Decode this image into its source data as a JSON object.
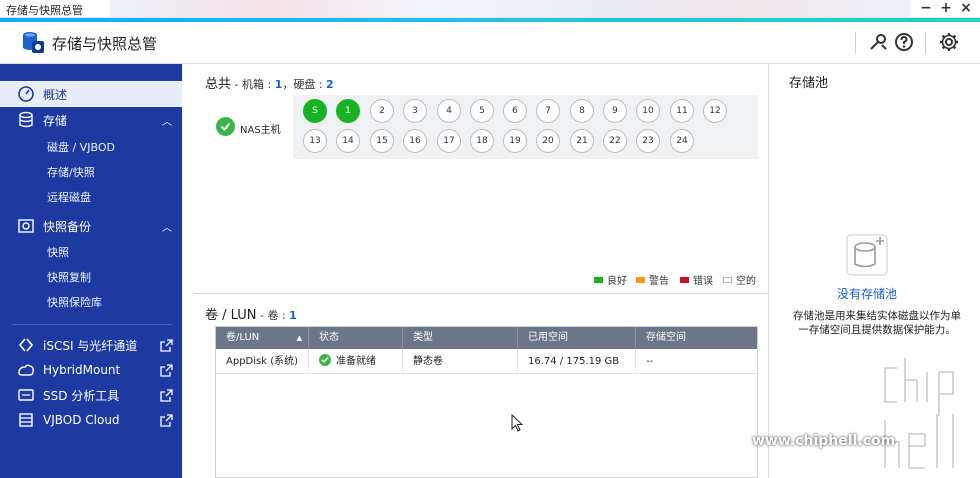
{
  "window": {
    "title": "存储与快照总管",
    "minimize": "−",
    "maximize": "+",
    "close": "×"
  },
  "header": {
    "app_title": "存储与快照总管"
  },
  "sidebar": {
    "items": [
      {
        "label": "概述"
      },
      {
        "label": "存储"
      },
      {
        "label": "磁盘 / VJBOD"
      },
      {
        "label": "存储/快照"
      },
      {
        "label": "远程磁盘"
      },
      {
        "label": "快照备份"
      },
      {
        "label": "快照"
      },
      {
        "label": "快照复制"
      },
      {
        "label": "快照保险库"
      },
      {
        "label": "iSCSI 与光纤通道"
      },
      {
        "label": "HybridMount"
      },
      {
        "label": "SSD 分析工具"
      },
      {
        "label": "VJBOD Cloud"
      }
    ]
  },
  "overview": {
    "title": "总共",
    "enclosure_label": " - 机箱 : ",
    "enclosure_count": "1",
    "disk_label": "，硬盘 : ",
    "disk_count": "2",
    "nas_label": "NAS主机",
    "bays_row1": [
      "S",
      "1",
      "2",
      "3",
      "4",
      "5",
      "6",
      "7",
      "8",
      "9",
      "10",
      "11",
      "12"
    ],
    "bays_row2": [
      "13",
      "14",
      "15",
      "16",
      "17",
      "18",
      "19",
      "20",
      "21",
      "22",
      "23",
      "24"
    ],
    "legend": [
      {
        "label": "良好",
        "color": "#17b323"
      },
      {
        "label": "警告",
        "color": "#f39a1c"
      },
      {
        "label": "错误",
        "color": "#c8102e"
      },
      {
        "label": "空的",
        "color": "#ffffff"
      }
    ]
  },
  "volumes": {
    "title": "卷 / LUN",
    "count_label": " - 卷 : ",
    "count": "1",
    "columns": [
      "卷/LUN",
      "状态",
      "类型",
      "已用空间",
      "存储空间"
    ],
    "sort_indicator": "▲",
    "rows": [
      {
        "name": "AppDisk (系统)",
        "status": "准备就绪",
        "type": "静态卷",
        "used": "16.74 / 175.19 GB",
        "pool": "--"
      }
    ]
  },
  "storage_pool": {
    "title": "存储池",
    "empty_link": "没有存储池",
    "description": "存储池是用来集结实体磁盘以作为单一存储空间且提供数据保护能力。"
  },
  "watermark": {
    "text": "www.chiphell.com"
  },
  "colors": {
    "sidebar": "#1c3aa1",
    "accent": "#11aaff",
    "ok": "#17b323",
    "link": "#1a5fd0"
  }
}
